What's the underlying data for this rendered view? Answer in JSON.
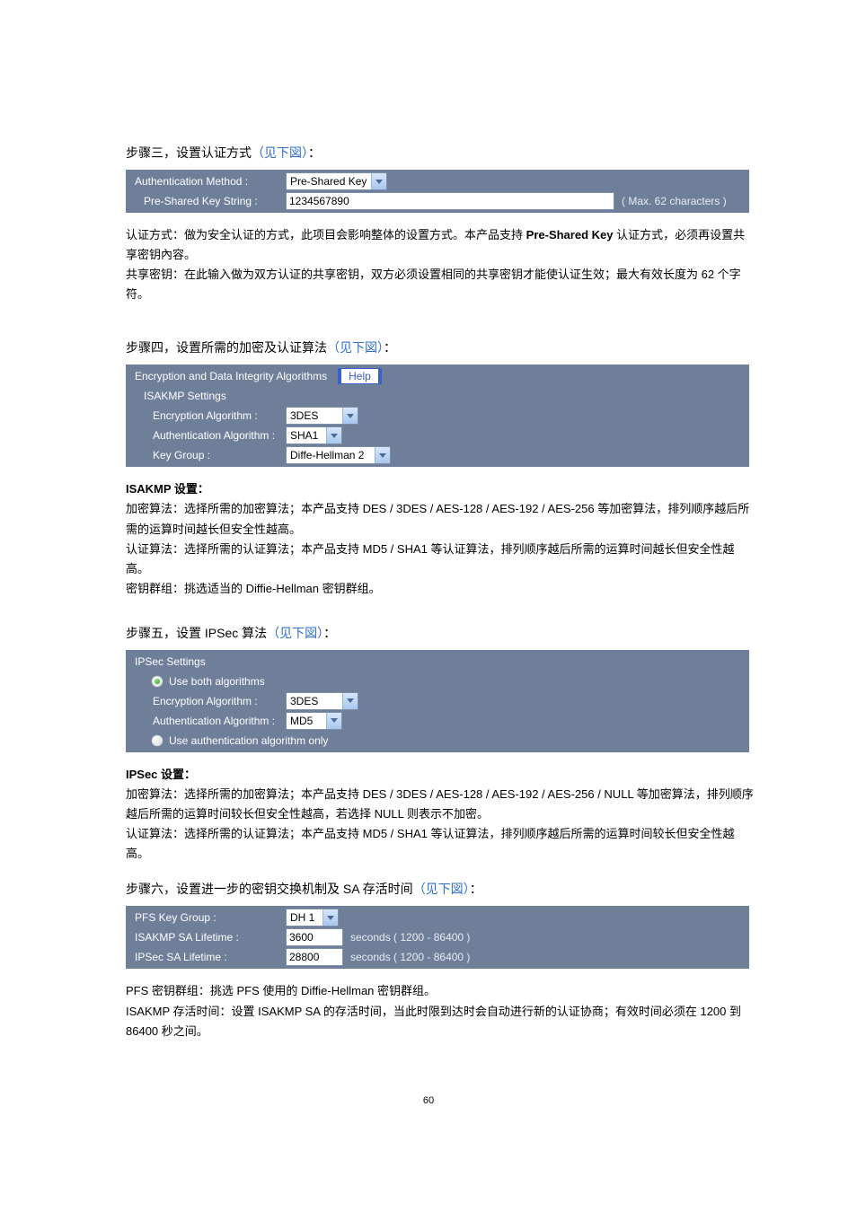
{
  "step1": {
    "heading_prefix": "步骤三，设置认证方式",
    "heading_paren": "（见下図）",
    "heading_suffix": "：",
    "auth_method_label": "Authentication Method :",
    "auth_method_value": "Pre-Shared Key",
    "psk_label": "Pre-Shared Key String :",
    "psk_value": "1234567890",
    "psk_hint": "( Max. 62 characters )",
    "desc1_prefix": "认证方式：",
    "desc1_body": "做为安全认证的方式，此项目会影响整体的设置方式。本产品支持",
    "desc1_bold": "Pre-Shared Key",
    "desc1_tail": " 认证方式，必须再设置共享密钥內容。",
    "desc2": "共享密钥：在此输入做为双方认证的共享密钥，双方必须设置相同的共享密钥才能使认证生效；最大有效长度为 62 个字符。"
  },
  "step2": {
    "heading_prefix": "步骤四，设置所需的加密及认证算法",
    "heading_paren": "（见下図）",
    "heading_suffix": "：",
    "section_title": "Encryption and Data Integrity Algorithms",
    "help_label": "Help",
    "isakmp_title": "ISAKMP Settings",
    "enc_label": "Encryption Algorithm :",
    "enc_value": "3DES",
    "auth_label": "Authentication Algorithm :",
    "auth_value": "SHA1",
    "keygroup_label": "Key Group :",
    "keygroup_value": "Diffe-Hellman 2",
    "desc_title": "ISAKMP 设置：",
    "desc1": "加密算法：选择所需的加密算法；本产品支持 DES / 3DES / AES-128 / AES-192 / AES-256 等加密算法，排列顺序越后所需的运算时间越长但安全性越高。",
    "desc2": "认证算法：选择所需的认证算法；本产品支持 MD5 / SHA1 等认证算法，排列顺序越后所需的运算时间越长但安全性越高。",
    "desc3": "密钥群组：挑选适当的 Diffie-Hellman 密钥群组。"
  },
  "step3": {
    "heading_prefix": "步骤五，设置 IPSec 算法",
    "heading_paren": "（见下図）",
    "heading_suffix": "：",
    "section_title": "IPSec Settings",
    "radio1_label": "Use both algorithms",
    "enc_label": "Encryption Algorithm :",
    "enc_value": "3DES",
    "auth_label": "Authentication Algorithm :",
    "auth_value": "MD5",
    "radio2_label": "Use authentication algorithm only",
    "desc_title": "IPSec 设置：",
    "desc1": "加密算法：选择所需的加密算法；本产品支持 DES / 3DES / AES-128 / AES-192 / AES-256 / NULL 等加密算法，排列顺序越后所需的运算时间较长但安全性越高，若选择 NULL 则表示不加密。",
    "desc2": "认证算法：选择所需的认证算法；本产品支持 MD5 / SHA1 等认证算法，排列顺序越后所需的运算时间较长但安全性越高。"
  },
  "step4": {
    "heading_prefix": "步骤六，设置进一步的密钥交换机制及 SA 存活时间",
    "heading_paren": "（见下図）",
    "heading_suffix": "：",
    "pfs_label": "PFS Key Group :",
    "pfs_value": "DH 1",
    "isakmp_life_label": "ISAKMP SA Lifetime :",
    "isakmp_life_value": "3600",
    "ipsec_life_label": "IPSec SA Lifetime :",
    "ipsec_life_value": "28800",
    "seconds_hint": "seconds ( 1200 - 86400 )",
    "desc1": "PFS 密钥群组：挑选 PFS 使用的 Diffie-Hellman 密钥群组。",
    "desc2": "ISAKMP 存活时间：设置 ISAKMP SA 的存活时间，当此时限到达时会自动进行新的认证协商；有效时间必须在 1200 到 86400 秒之间。"
  },
  "page_number": "60"
}
